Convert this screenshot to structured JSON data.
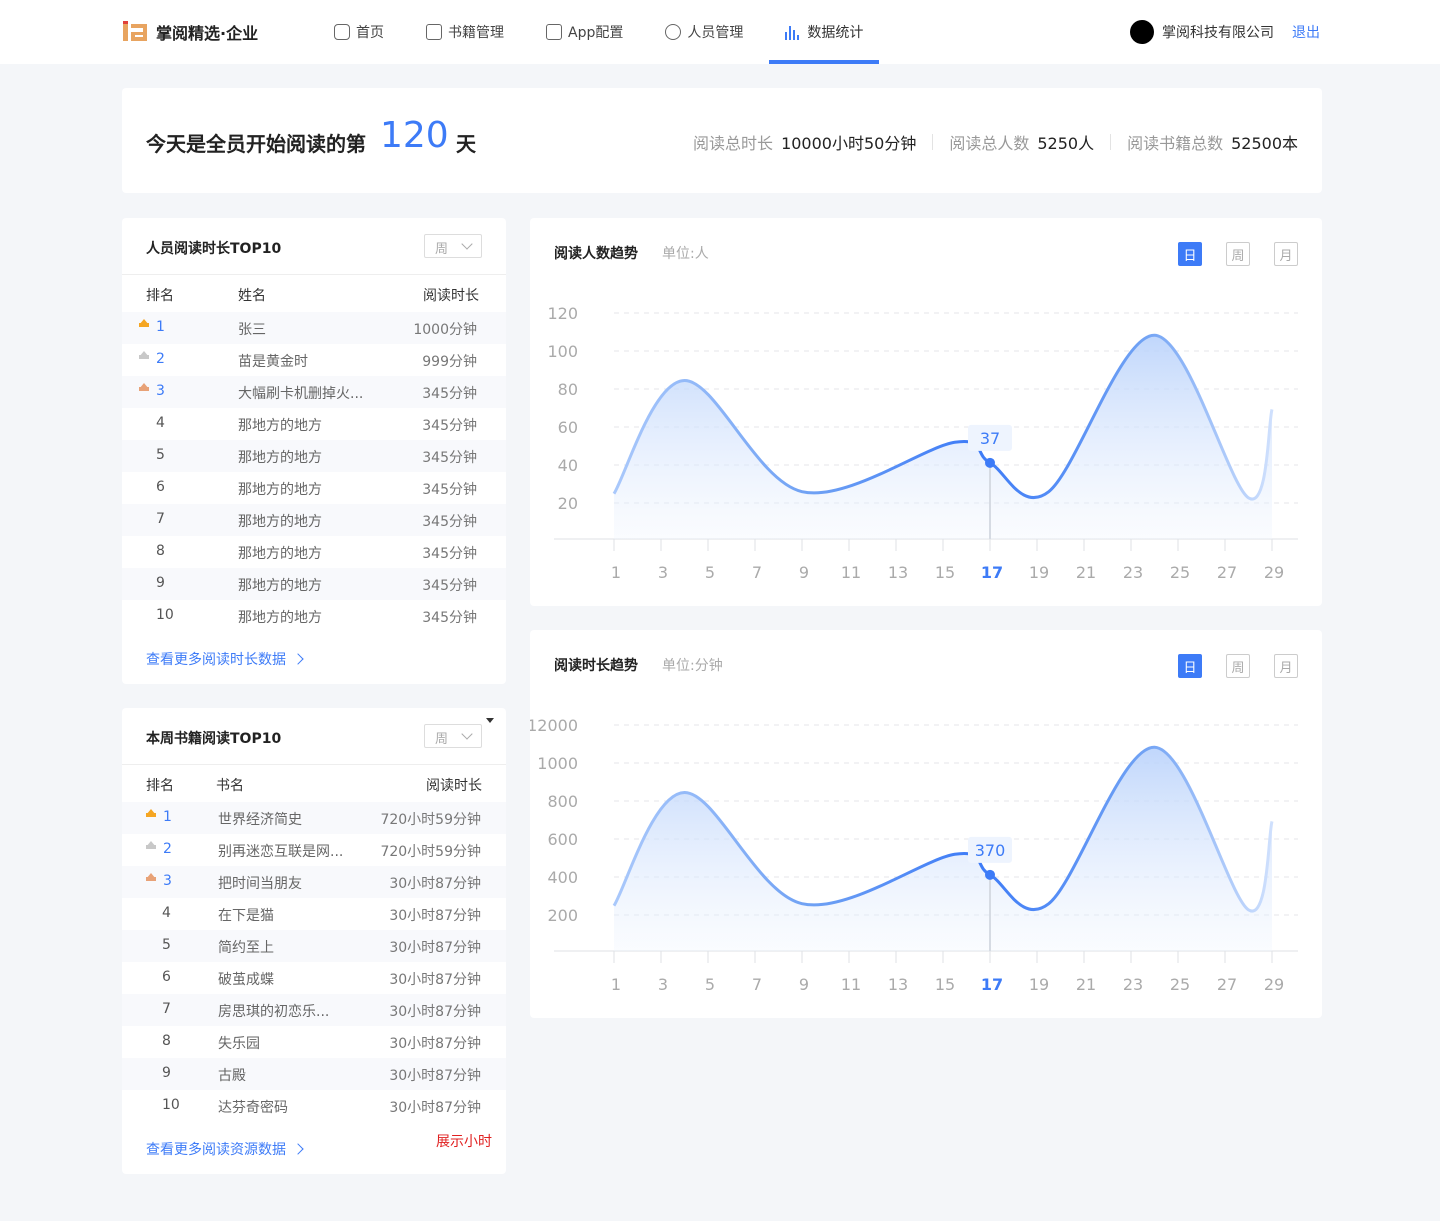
{
  "header": {
    "logo_text": "掌阅精选·企业",
    "nav": [
      {
        "label": "首页",
        "icon": "cube-icon",
        "active": false
      },
      {
        "label": "书籍管理",
        "icon": "book-icon",
        "active": false
      },
      {
        "label": "App配置",
        "icon": "image-icon",
        "active": false
      },
      {
        "label": "人员管理",
        "icon": "user-icon",
        "active": false
      },
      {
        "label": "数据统计",
        "icon": "bar-chart-icon",
        "active": true
      }
    ],
    "company": "掌阅科技有限公司",
    "logout": "退出"
  },
  "banner": {
    "prefix": "今天是全员开始阅读的第",
    "days": "120",
    "suffix": "天",
    "stats": [
      {
        "label": "阅读总时长",
        "value": "10000小时50分钟"
      },
      {
        "label": "阅读总人数",
        "value": "5250人"
      },
      {
        "label": "阅读书籍总数",
        "value": "52500本"
      }
    ]
  },
  "people_top": {
    "title": "人员阅读时长TOP10",
    "select": "周",
    "headers": [
      "排名",
      "姓名",
      "阅读时长"
    ],
    "rows": [
      {
        "rank": "1",
        "name": "张三",
        "value": "1000分钟"
      },
      {
        "rank": "2",
        "name": "苗是黄金时",
        "value": "999分钟"
      },
      {
        "rank": "3",
        "name": "大幅刷卡机删掉火...",
        "value": "345分钟"
      },
      {
        "rank": "4",
        "name": "那地方的地方",
        "value": "345分钟"
      },
      {
        "rank": "5",
        "name": "那地方的地方",
        "value": "345分钟"
      },
      {
        "rank": "6",
        "name": "那地方的地方",
        "value": "345分钟"
      },
      {
        "rank": "7",
        "name": "那地方的地方",
        "value": "345分钟"
      },
      {
        "rank": "8",
        "name": "那地方的地方",
        "value": "345分钟"
      },
      {
        "rank": "9",
        "name": "那地方的地方",
        "value": "345分钟"
      },
      {
        "rank": "10",
        "name": "那地方的地方",
        "value": "345分钟"
      }
    ],
    "more": "查看更多阅读时长数据"
  },
  "books_top": {
    "title": "本周书籍阅读TOP10",
    "select": "周",
    "headers": [
      "排名",
      "书名",
      "阅读时长"
    ],
    "rows": [
      {
        "rank": "1",
        "name": "世界经济简史",
        "value": "720小时59分钟"
      },
      {
        "rank": "2",
        "name": "别再迷恋互联是网...",
        "value": "720小时59分钟"
      },
      {
        "rank": "3",
        "name": "把时间当朋友",
        "value": "30小时87分钟"
      },
      {
        "rank": "4",
        "name": "在下是猫",
        "value": "30小时87分钟"
      },
      {
        "rank": "5",
        "name": "简约至上",
        "value": "30小时87分钟"
      },
      {
        "rank": "6",
        "name": "破茧成蝶",
        "value": "30小时87分钟"
      },
      {
        "rank": "7",
        "name": "房思琪的初恋乐...",
        "value": "30小时87分钟"
      },
      {
        "rank": "8",
        "name": "失乐园",
        "value": "30小时87分钟"
      },
      {
        "rank": "9",
        "name": "古殿",
        "value": "30小时87分钟"
      },
      {
        "rank": "10",
        "name": "达芬奇密码",
        "value": "30小时87分钟"
      }
    ],
    "more": "查看更多阅读资源数据",
    "note": "展示小时"
  },
  "trend_people": {
    "title": "阅读人数趋势",
    "unit": "单位:人",
    "tabs": [
      "日",
      "周",
      "月"
    ],
    "active_tab": "日"
  },
  "trend_time": {
    "title": "阅读时长趋势",
    "unit": "单位:分钟",
    "tabs": [
      "日",
      "周",
      "月"
    ],
    "active_tab": "日"
  },
  "colors": {
    "accent": "#3d7bf7",
    "gold": "#f5a623",
    "silver": "#c8c8c8",
    "bronze": "#e8a277",
    "note": "#e02020"
  },
  "chart_data": [
    {
      "type": "area",
      "title": "阅读人数趋势",
      "x": [
        1,
        3,
        5,
        7,
        9,
        11,
        13,
        15,
        17,
        19,
        21,
        23,
        25,
        27,
        29
      ],
      "x_highlight": 17,
      "y_ticks": [
        "120",
        "100",
        "80",
        "60",
        "40",
        "20"
      ],
      "ylim": [
        0,
        120
      ],
      "series": [
        {
          "points": [
            [
              1,
              22
            ],
            [
              4,
              77
            ],
            [
              9,
              23
            ],
            [
              15.5,
              47
            ],
            [
              17,
              37
            ],
            [
              19.5,
              23
            ],
            [
              24,
              99
            ],
            [
              28,
              20
            ],
            [
              29,
              63
            ]
          ]
        }
      ],
      "tooltip": {
        "x": 17,
        "label": "37"
      },
      "grid": true
    },
    {
      "type": "area",
      "title": "阅读时长趋势",
      "x": [
        1,
        3,
        5,
        7,
        9,
        11,
        13,
        15,
        17,
        19,
        21,
        23,
        25,
        27,
        29
      ],
      "x_highlight": 17,
      "y_ticks": [
        "12000",
        "1000",
        "800",
        "600",
        "400",
        "200"
      ],
      "ylim": [
        0,
        1200
      ],
      "series": [
        {
          "points": [
            [
              1,
              220
            ],
            [
              4,
              770
            ],
            [
              9,
              230
            ],
            [
              15.5,
              470
            ],
            [
              17,
              370
            ],
            [
              19.5,
              230
            ],
            [
              24,
              990
            ],
            [
              28,
              200
            ],
            [
              29,
              630
            ]
          ]
        }
      ],
      "tooltip": {
        "x": 17,
        "label": "370"
      },
      "grid": true
    }
  ]
}
